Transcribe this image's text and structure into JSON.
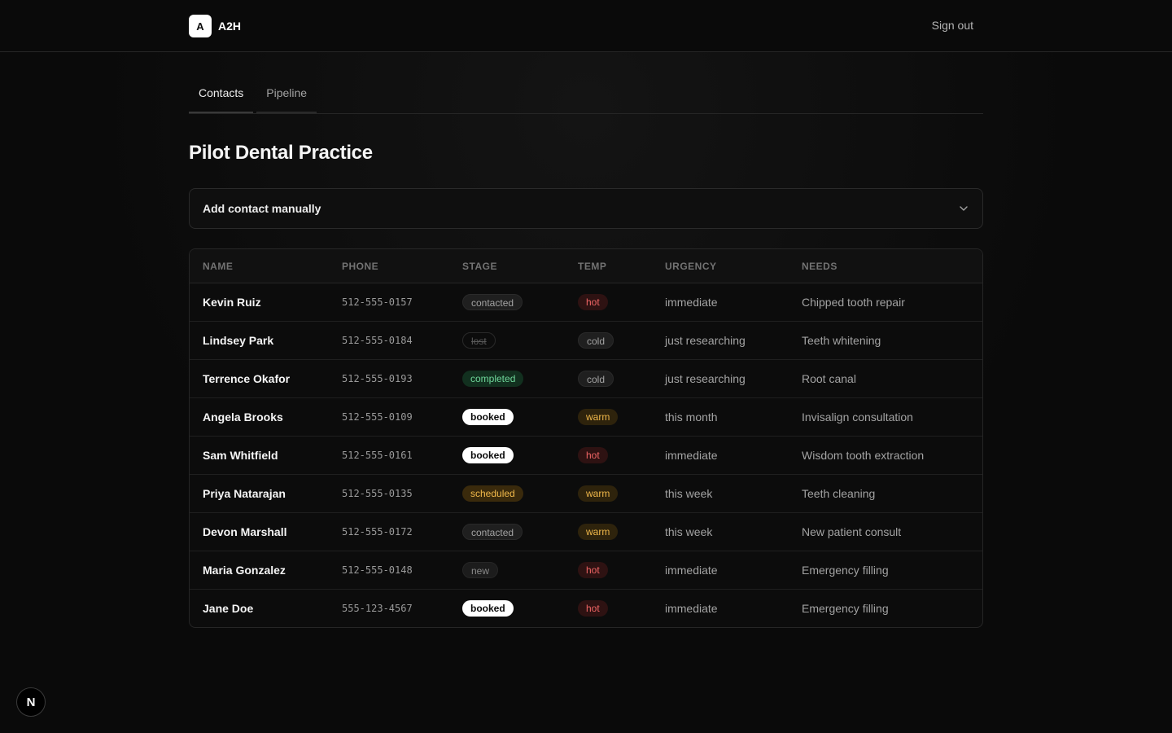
{
  "header": {
    "logo_letter": "A",
    "brand_name": "A2H",
    "signout_label": "Sign out"
  },
  "tabs": [
    {
      "label": "Contacts",
      "active": true
    },
    {
      "label": "Pipeline",
      "active": false
    }
  ],
  "page": {
    "title": "Pilot Dental Practice"
  },
  "add_contact": {
    "label": "Add contact manually"
  },
  "table": {
    "columns": [
      "NAME",
      "PHONE",
      "STAGE",
      "TEMP",
      "URGENCY",
      "NEEDS"
    ],
    "rows": [
      {
        "name": "Kevin Ruiz",
        "phone": "512-555-0157",
        "stage": "contacted",
        "temp": "hot",
        "urgency": "immediate",
        "needs": "Chipped tooth repair"
      },
      {
        "name": "Lindsey Park",
        "phone": "512-555-0184",
        "stage": "lost",
        "temp": "cold",
        "urgency": "just researching",
        "needs": "Teeth whitening"
      },
      {
        "name": "Terrence Okafor",
        "phone": "512-555-0193",
        "stage": "completed",
        "temp": "cold",
        "urgency": "just researching",
        "needs": "Root canal"
      },
      {
        "name": "Angela Brooks",
        "phone": "512-555-0109",
        "stage": "booked",
        "temp": "warm",
        "urgency": "this month",
        "needs": "Invisalign consultation"
      },
      {
        "name": "Sam Whitfield",
        "phone": "512-555-0161",
        "stage": "booked",
        "temp": "hot",
        "urgency": "immediate",
        "needs": "Wisdom tooth extraction"
      },
      {
        "name": "Priya Natarajan",
        "phone": "512-555-0135",
        "stage": "scheduled",
        "temp": "warm",
        "urgency": "this week",
        "needs": "Teeth cleaning"
      },
      {
        "name": "Devon Marshall",
        "phone": "512-555-0172",
        "stage": "contacted",
        "temp": "warm",
        "urgency": "this week",
        "needs": "New patient consult"
      },
      {
        "name": "Maria Gonzalez",
        "phone": "512-555-0148",
        "stage": "new",
        "temp": "hot",
        "urgency": "immediate",
        "needs": "Emergency filling"
      },
      {
        "name": "Jane Doe",
        "phone": "555-123-4567",
        "stage": "booked",
        "temp": "hot",
        "urgency": "immediate",
        "needs": "Emergency filling"
      }
    ]
  },
  "dev_badge": {
    "letter": "N"
  },
  "icons": {
    "add_contact_toggle": "chevron-down-icon"
  },
  "colors": {
    "background": "#0a0a0a",
    "hot": "#f06565",
    "warm": "#f0b84a",
    "completed": "#6fd79a",
    "booked_bg": "#ffffff"
  }
}
